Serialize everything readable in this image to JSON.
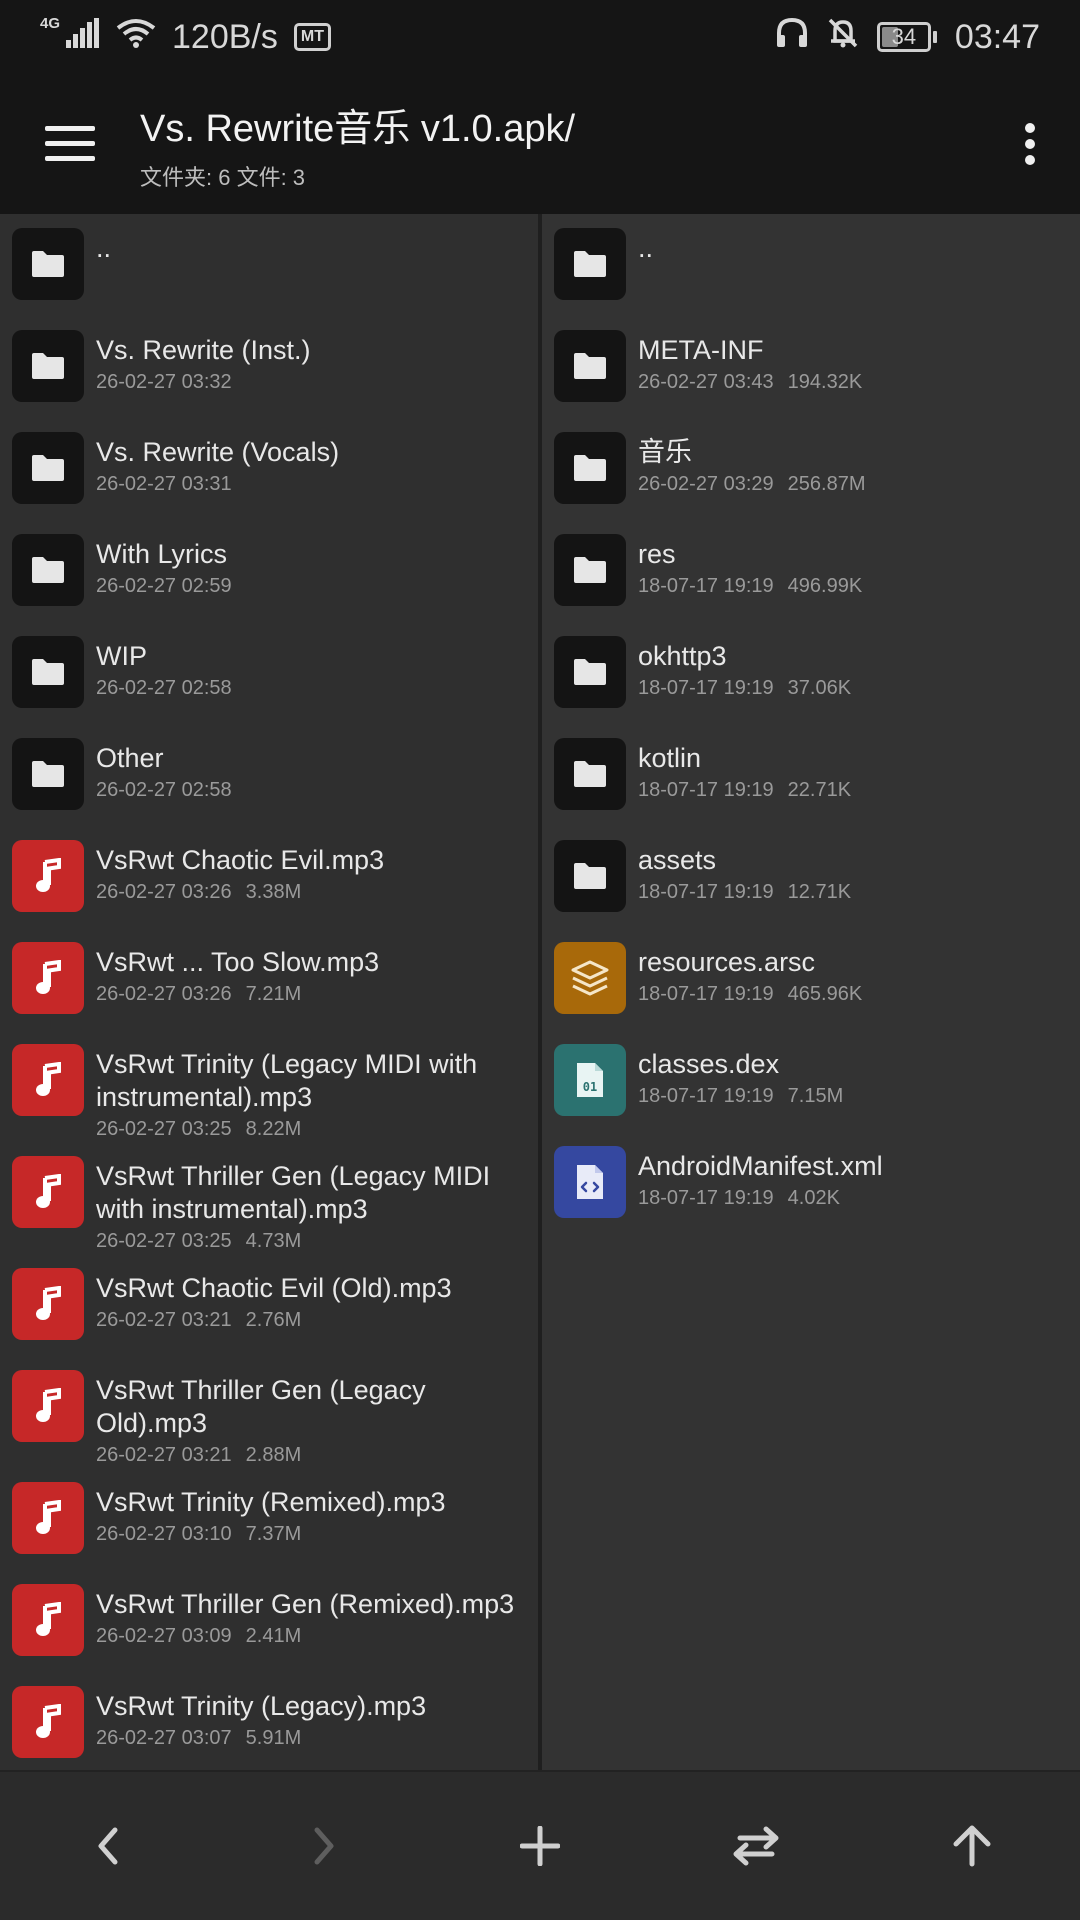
{
  "status_bar": {
    "network": "4G",
    "speed": "120B/s",
    "mt_badge": "MT",
    "battery": "34",
    "battery_level": 0.34,
    "time": "03:47"
  },
  "app_bar": {
    "title": "Vs. Rewrite音乐 v1.0.apk/",
    "subtitle": "文件夹: 6  文件: 3"
  },
  "left_pane": {
    "items": [
      {
        "name": "..",
        "date": "",
        "size": "",
        "type": "folder"
      },
      {
        "name": "Vs. Rewrite (Inst.)",
        "date": "26-02-27 03:32",
        "size": "",
        "type": "folder"
      },
      {
        "name": "Vs. Rewrite (Vocals)",
        "date": "26-02-27 03:31",
        "size": "",
        "type": "folder"
      },
      {
        "name": "With Lyrics",
        "date": "26-02-27 02:59",
        "size": "",
        "type": "folder"
      },
      {
        "name": "WIP",
        "date": "26-02-27 02:58",
        "size": "",
        "type": "folder"
      },
      {
        "name": "Other",
        "date": "26-02-27 02:58",
        "size": "",
        "type": "folder"
      },
      {
        "name": "VsRwt Chaotic Evil.mp3",
        "date": "26-02-27 03:26",
        "size": "3.38M",
        "type": "music"
      },
      {
        "name": "VsRwt ... Too Slow.mp3",
        "date": "26-02-27 03:26",
        "size": "7.21M",
        "type": "music"
      },
      {
        "name": "VsRwt Trinity (Legacy MIDI with instrumental).mp3",
        "date": "26-02-27 03:25",
        "size": "8.22M",
        "type": "music"
      },
      {
        "name": "VsRwt Thriller Gen (Legacy MIDI with instrumental).mp3",
        "date": "26-02-27 03:25",
        "size": "4.73M",
        "type": "music"
      },
      {
        "name": "VsRwt Chaotic Evil (Old).mp3",
        "date": "26-02-27 03:21",
        "size": "2.76M",
        "type": "music"
      },
      {
        "name": "VsRwt Thriller Gen (Legacy Old).mp3",
        "date": "26-02-27 03:21",
        "size": "2.88M",
        "type": "music"
      },
      {
        "name": "VsRwt Trinity (Remixed).mp3",
        "date": "26-02-27 03:10",
        "size": "7.37M",
        "type": "music"
      },
      {
        "name": "VsRwt Thriller Gen (Remixed).mp3",
        "date": "26-02-27 03:09",
        "size": "2.41M",
        "type": "music"
      },
      {
        "name": "VsRwt Trinity (Legacy).mp3",
        "date": "26-02-27 03:07",
        "size": "5.91M",
        "type": "music"
      }
    ]
  },
  "right_pane": {
    "items": [
      {
        "name": "..",
        "date": "",
        "size": "",
        "type": "folder"
      },
      {
        "name": "META-INF",
        "date": "26-02-27 03:43",
        "size": "194.32K",
        "type": "folder"
      },
      {
        "name": "音乐",
        "date": "26-02-27 03:29",
        "size": "256.87M",
        "type": "folder"
      },
      {
        "name": "res",
        "date": "18-07-17 19:19",
        "size": "496.99K",
        "type": "folder"
      },
      {
        "name": "okhttp3",
        "date": "18-07-17 19:19",
        "size": "37.06K",
        "type": "folder"
      },
      {
        "name": "kotlin",
        "date": "18-07-17 19:19",
        "size": "22.71K",
        "type": "folder"
      },
      {
        "name": "assets",
        "date": "18-07-17 19:19",
        "size": "12.71K",
        "type": "folder"
      },
      {
        "name": "resources.arsc",
        "date": "18-07-17 19:19",
        "size": "465.96K",
        "type": "arsc"
      },
      {
        "name": "classes.dex",
        "date": "18-07-17 19:19",
        "size": "7.15M",
        "type": "dex"
      },
      {
        "name": "AndroidManifest.xml",
        "date": "18-07-17 19:19",
        "size": "4.02K",
        "type": "xml"
      }
    ]
  },
  "icons": {
    "folder": "folder-icon",
    "music": "music-note-icon",
    "arsc": "layers-icon",
    "dex": "binary-file-icon",
    "xml": "code-file-icon"
  },
  "bottom_nav": [
    {
      "name": "back-button",
      "icon": "chevron-left-icon",
      "enabled": true
    },
    {
      "name": "forward-button",
      "icon": "chevron-right-icon",
      "enabled": false
    },
    {
      "name": "add-button",
      "icon": "plus-icon",
      "enabled": true
    },
    {
      "name": "swap-panes-button",
      "icon": "swap-icon",
      "enabled": true
    },
    {
      "name": "go-up-button",
      "icon": "arrow-up-icon",
      "enabled": true
    }
  ],
  "colors": {
    "folder_tile": "#141414",
    "music_tile": "#c62828",
    "arsc_tile": "#a8690a",
    "dex_tile": "#2b7270",
    "xml_tile": "#3548a0"
  }
}
